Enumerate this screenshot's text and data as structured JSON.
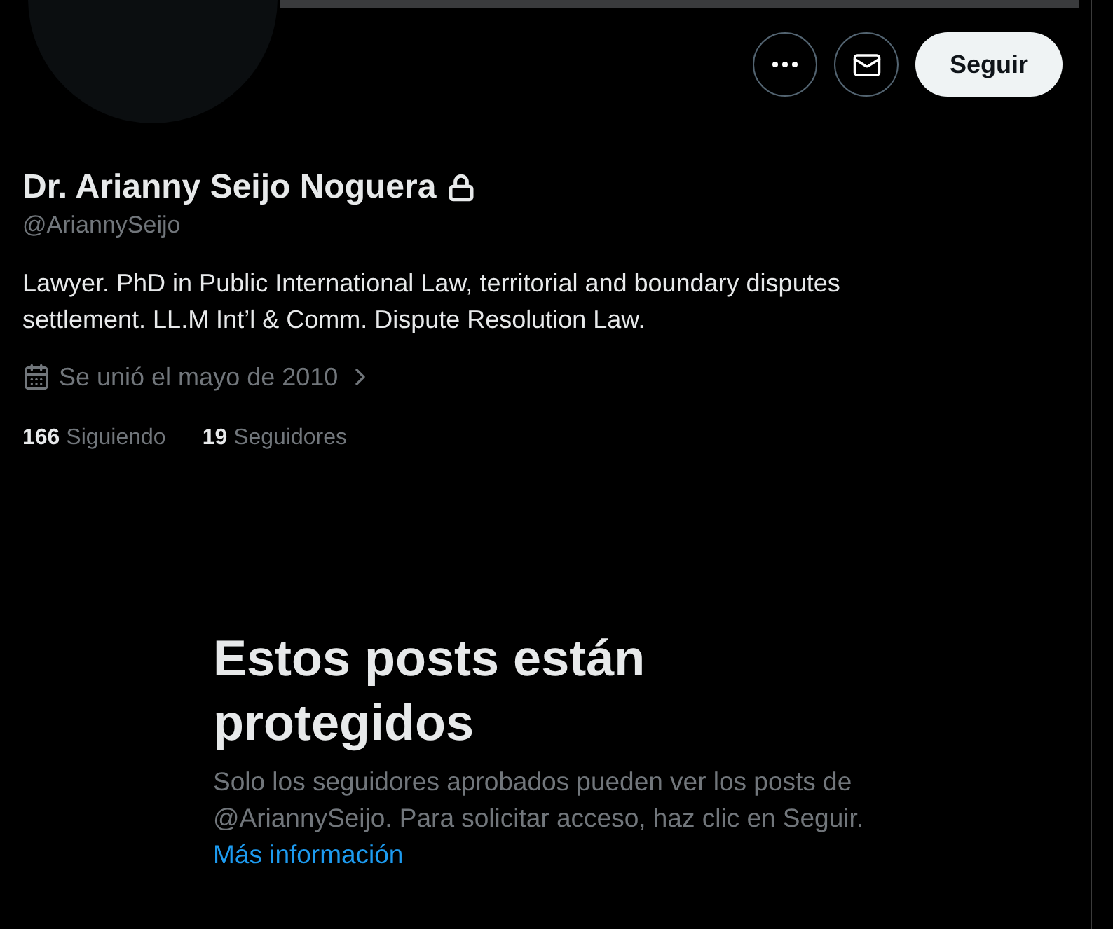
{
  "profile": {
    "name": "Dr. Arianny Seijo Noguera",
    "protected": true,
    "handle": "@AriannySeijo",
    "bio": "Lawyer. PhD in Public International Law, territorial and boundary disputes settlement. LL.M Int’l & Comm. Dispute Resolution Law.",
    "joined": "Se unió el mayo de 2010"
  },
  "actions": {
    "follow": "Seguir"
  },
  "stats": [
    {
      "count": "166",
      "label": "Siguiendo"
    },
    {
      "count": "19",
      "label": "Seguidores"
    }
  ],
  "protected_notice": {
    "title": "Estos posts están protegidos",
    "text": "Solo los seguidores aprobados pueden ver los posts de @AriannySeijo. Para solicitar acceso, haz clic en Seguir.",
    "link": "Más información"
  }
}
